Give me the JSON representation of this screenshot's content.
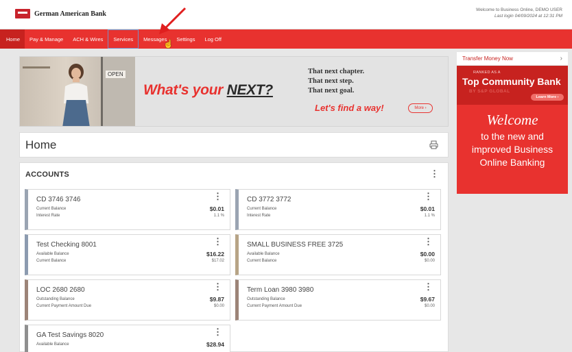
{
  "header": {
    "bank_name": "German American Bank",
    "welcome_line1": "Welcome to Business Online, DEMO USER",
    "welcome_line2": "Last login 04/09/2024 at 12:31 PM"
  },
  "nav": {
    "home": "Home",
    "pay_manage": "Pay & Manage",
    "ach_wires": "ACH & Wires",
    "services": "Services",
    "messages": "Messages",
    "settings": "Settings",
    "log_off": "Log Off"
  },
  "banner": {
    "open_sign": "OPEN",
    "headline_pre": "What's your ",
    "headline_next": "NEXT?",
    "tag1": "That next chapter.",
    "tag2": "That next step.",
    "tag3": "That next goal.",
    "cta": "Let's find a way!",
    "more": "More ›"
  },
  "sidebar": {
    "transfer": "Transfer Money Now",
    "chevron": "›",
    "ranked_as": "RANKED AS A",
    "rank_title": "Top Community Bank",
    "rank_sub": "BY S&P GLOBAL",
    "learn_more": "Learn More ›",
    "welcome_script": "Welcome",
    "welcome_l1": "to the new and",
    "welcome_l2": "improved Business",
    "welcome_l3": "Online Banking"
  },
  "page": {
    "title": "Home"
  },
  "accounts": {
    "title": "ACCOUNTS",
    "list": [
      {
        "name": "CD 3746 3746",
        "label1": "Current Balance",
        "value1": "$0.01",
        "label2": "Interest Rate",
        "value2": "1.1 %",
        "color": "#9aa4b2"
      },
      {
        "name": "CD 3772 3772",
        "label1": "Current Balance",
        "value1": "$0.01",
        "label2": "Interest Rate",
        "value2": "1.1 %",
        "color": "#9aa4b2"
      },
      {
        "name": "Test Checking 8001",
        "label1": "Available Balance",
        "value1": "$16.22",
        "label2": "Current Balance",
        "value2": "$17.02",
        "color": "#8c9bb0"
      },
      {
        "name": "SMALL BUSINESS FREE 3725",
        "label1": "Available Balance",
        "value1": "$0.00",
        "label2": "Current Balance",
        "value2": "$0.00",
        "color": "#b7a486"
      },
      {
        "name": "LOC 2680 2680",
        "label1": "Outstanding Balance",
        "value1": "$9.87",
        "label2": "Current Payment Amount Due",
        "value2": "$0.00",
        "color": "#9c8478"
      },
      {
        "name": "Term Loan 3980 3980",
        "label1": "Outstanding Balance",
        "value1": "$9.67",
        "label2": "Current Payment Amount Due",
        "value2": "$0.00",
        "color": "#9c8478"
      },
      {
        "name": "GA Test Savings 8020",
        "label1": "Available Balance",
        "value1": "$28.94",
        "label2": "",
        "value2": "",
        "color": "#8f8f8f"
      }
    ]
  },
  "colors": {
    "brand_red": "#e8322f",
    "brand_dark_red": "#c7221f"
  }
}
